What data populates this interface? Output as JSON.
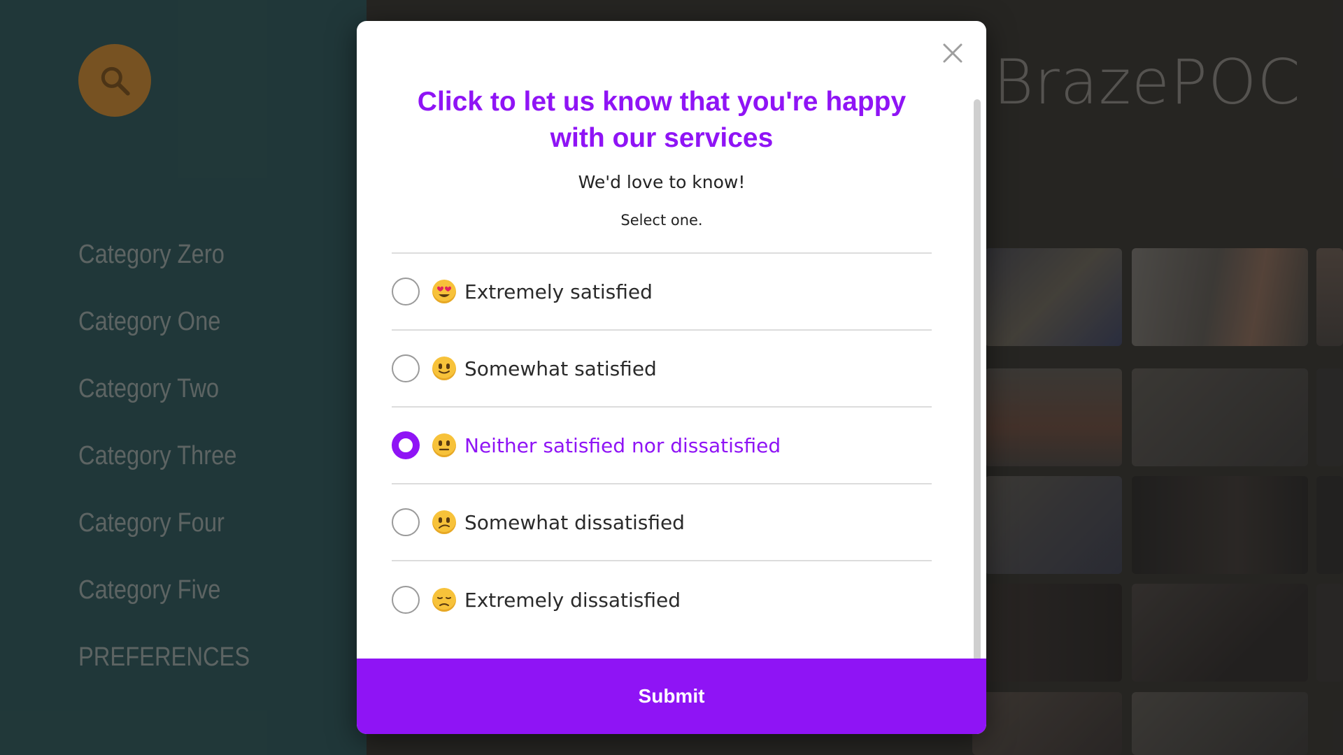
{
  "app": {
    "title": "BrazePOC"
  },
  "sidebar": {
    "search_icon": "search-icon",
    "items": [
      {
        "label": "Category Zero"
      },
      {
        "label": "Category One"
      },
      {
        "label": "Category Two"
      },
      {
        "label": "Category Three"
      },
      {
        "label": "Category Four"
      },
      {
        "label": "Category Five"
      },
      {
        "label": "PREFERENCES"
      }
    ]
  },
  "modal": {
    "close_icon": "close-icon",
    "title": "Click to let us know that you're happy with our services",
    "subtitle": "We'd love to know!",
    "hint": "Select one.",
    "options": [
      {
        "emoji": "heart-eyes-emoji",
        "label": "Extremely satisfied",
        "selected": false
      },
      {
        "emoji": "slight-smile-emoji",
        "label": "Somewhat satisfied",
        "selected": false
      },
      {
        "emoji": "neutral-face-emoji",
        "label": "Neither satisfied nor dissatisfied",
        "selected": true
      },
      {
        "emoji": "confused-face-emoji",
        "label": "Somewhat dissatisfied",
        "selected": false
      },
      {
        "emoji": "pensive-face-emoji",
        "label": "Extremely dissatisfied",
        "selected": false
      }
    ],
    "submit_label": "Submit"
  },
  "colors": {
    "accent": "#8f14f5",
    "sidebar_bg": "#2b5558",
    "search_button": "#c9862f"
  }
}
